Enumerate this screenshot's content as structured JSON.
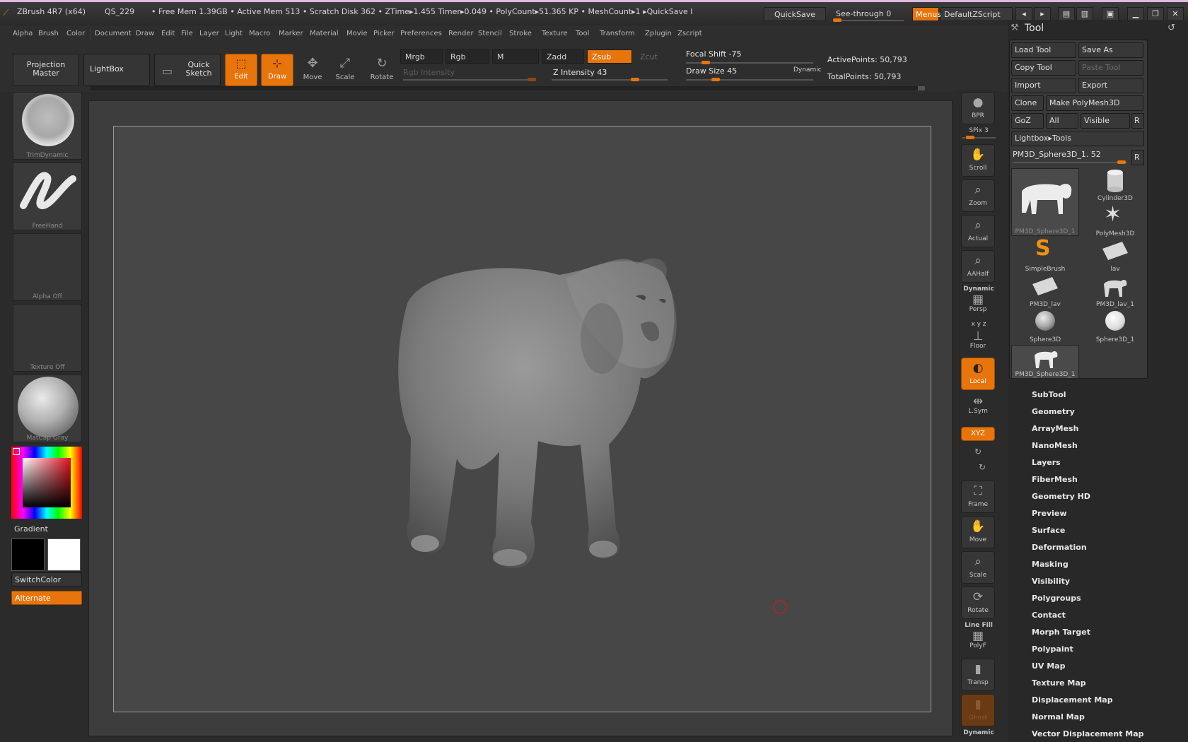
{
  "titlebar": {
    "app": "ZBrush 4R7 (x64)",
    "qs": "QS_229",
    "status": "• Free Mem 1.39GB • Active Mem 513 • Scratch Disk 362 •  ZTime▸1.455 Timer▸0.049 • PolyCount▸51.365 KP • MeshCount▸1  ▸QuickSave I",
    "quicksave": "QuickSave",
    "see_through": "See-through  0",
    "see_through_value": 0,
    "menus": "Menus",
    "zscript": "DefaultZScript"
  },
  "menubar": [
    "Alpha",
    "Brush",
    "Color",
    "Document",
    "Draw",
    "Edit",
    "File",
    "Layer",
    "Light",
    "Macro",
    "Marker",
    "Material",
    "Movie",
    "Picker",
    "Preferences",
    "Render",
    "Stencil",
    "Stroke",
    "Texture",
    "Tool",
    "Transform",
    "Zplugin",
    "Zscript"
  ],
  "shelf": {
    "projection_master": "Projection Master",
    "lightbox": "LightBox",
    "quick_sketch": "Quick Sketch",
    "edit": "Edit",
    "draw": "Draw",
    "move": "Move",
    "scale": "Scale",
    "rotate": "Rotate",
    "mrgb": "Mrgb",
    "rgb": "Rgb",
    "m": "M",
    "zadd": "Zadd",
    "zsub": "Zsub",
    "zcut": "Zcut",
    "rgb_intensity": "Rgb Intensity",
    "z_intensity": "Z Intensity 43",
    "z_intensity_value": 43,
    "focal_shift": "Focal Shift -75",
    "focal_shift_value": -75,
    "draw_size": "Draw Size 45",
    "draw_size_value": 45,
    "dynamic": "Dynamic",
    "active_points": "ActivePoints: 50,793",
    "total_points": "TotalPoints: 50,793"
  },
  "left": {
    "brush": "TrimDynamic",
    "stroke": "FreeHand",
    "alpha": "Alpha Off",
    "texture": "Texture Off",
    "material": "MatCap Gray",
    "gradient": "Gradient",
    "switchcolor": "SwitchColor",
    "alternate": "Alternate",
    "colors": {
      "main": "#000000",
      "secondary": "#ffffff",
      "accent": "#e8740c"
    }
  },
  "right_shelf": {
    "bpr": "BPR",
    "spix": "SPix 3",
    "scroll": "Scroll",
    "zoom": "Zoom",
    "actual": "Actual",
    "aahalf": "AAHalf",
    "dynamic": "Dynamic",
    "persp": "Persp",
    "xyz_small": "x y z",
    "floor": "Floor",
    "local": "Local",
    "lsym": "L.Sym",
    "xyz": "XYZ",
    "frame": "Frame",
    "move": "Move",
    "scale": "Scale",
    "rotate": "Rotate",
    "line_fill": "Line Fill",
    "polyf": "PolyF",
    "transp": "Transp",
    "ghost": "Ghost",
    "dynamic2": "Dynamic"
  },
  "tool": {
    "title": "Tool",
    "load": "Load Tool",
    "save_as": "Save As",
    "copy": "Copy Tool",
    "paste": "Paste Tool",
    "import": "Import",
    "export": "Export",
    "clone": "Clone",
    "make_polymesh": "Make PolyMesh3D",
    "goz": "GoZ",
    "all": "All",
    "visible": "Visible",
    "r": "R",
    "lightbox_tools": "Lightbox▸Tools",
    "current": "PM3D_Sphere3D_1. 52",
    "items": [
      {
        "label": "PM3D_Sphere3D_1",
        "icon": "lion-icon"
      },
      {
        "label": "Cylinder3D",
        "icon": "cylinder-icon"
      },
      {
        "label": "PolyMesh3D",
        "icon": "star-icon"
      },
      {
        "label": "SimpleBrush",
        "icon": "simplebrush-icon"
      },
      {
        "label": "lav",
        "icon": "plane-icon"
      },
      {
        "label": "PM3D_lav",
        "icon": "plane-icon"
      },
      {
        "label": "PM3D_lav_1",
        "icon": "lion-icon"
      },
      {
        "label": "Sphere3D",
        "icon": "sphere-icon"
      },
      {
        "label": "Sphere3D_1",
        "icon": "sphere-icon"
      },
      {
        "label": "PM3D_Sphere3D_1",
        "icon": "lion-icon"
      }
    ],
    "sections": [
      "SubTool",
      "Geometry",
      "ArrayMesh",
      "NanoMesh",
      "Layers",
      "FiberMesh",
      "Geometry HD",
      "Preview",
      "Surface",
      "Deformation",
      "Masking",
      "Visibility",
      "Polygroups",
      "Contact",
      "Morph Target",
      "Polypaint",
      "UV Map",
      "Texture Map",
      "Displacement Map",
      "Normal Map",
      "Vector Displacement Map"
    ]
  }
}
